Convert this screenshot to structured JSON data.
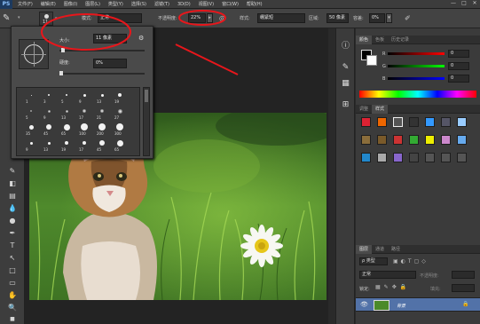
{
  "app": {
    "logo": "PS",
    "menu": [
      "文件(F)",
      "编辑(E)",
      "图像(I)",
      "图层(L)",
      "类型(Y)",
      "选择(S)",
      "滤镜(T)",
      "3D(D)",
      "视图(V)",
      "窗口(W)",
      "帮助(H)"
    ],
    "window_controls": [
      "—",
      "□",
      "✕"
    ]
  },
  "options_bar": {
    "brush_size_preview": "11",
    "mode_label": "模式:",
    "mode_value": "正常",
    "opacity_label": "不透明度:",
    "opacity_value": "22%",
    "style_label": "样式:",
    "style_value": "绷紧短",
    "area_label": "区域:",
    "area_value": "50 像素",
    "tolerance_label": "容差:",
    "tolerance_value": "0%"
  },
  "brush_popup": {
    "size_label": "大小:",
    "size_value": "11 像素",
    "hardness_label": "硬度:",
    "hardness_value": "0%",
    "preset_sizes": [
      [
        "1",
        "3",
        "5",
        "9",
        "13",
        "19"
      ],
      [
        "5",
        "9",
        "13",
        "17",
        "21",
        "27"
      ],
      [
        "35",
        "45",
        "65",
        "100",
        "200",
        "300"
      ],
      [
        "9",
        "13",
        "19",
        "17",
        "45",
        "65"
      ]
    ]
  },
  "right_panels": {
    "color_tabs": [
      "颜色",
      "色板",
      "历史记录"
    ],
    "rgb_labels": [
      "R",
      "G",
      "B"
    ],
    "rgb_values": [
      "0",
      "0",
      "0"
    ],
    "adjust_tabs": [
      "调整",
      "样式"
    ],
    "layers_tabs": [
      "图层",
      "通道",
      "路径"
    ],
    "layer_kind": "ρ 类型",
    "blend_mode": "正常",
    "layer_opacity_label": "不透明度:",
    "lock_label": "锁定:",
    "fill_label": "填充:",
    "layer_name": "背景"
  },
  "colors": {
    "annotation_red": "#e8161b",
    "accent_blue": "#4a6da8",
    "panel_bg": "#3b3b3b"
  }
}
